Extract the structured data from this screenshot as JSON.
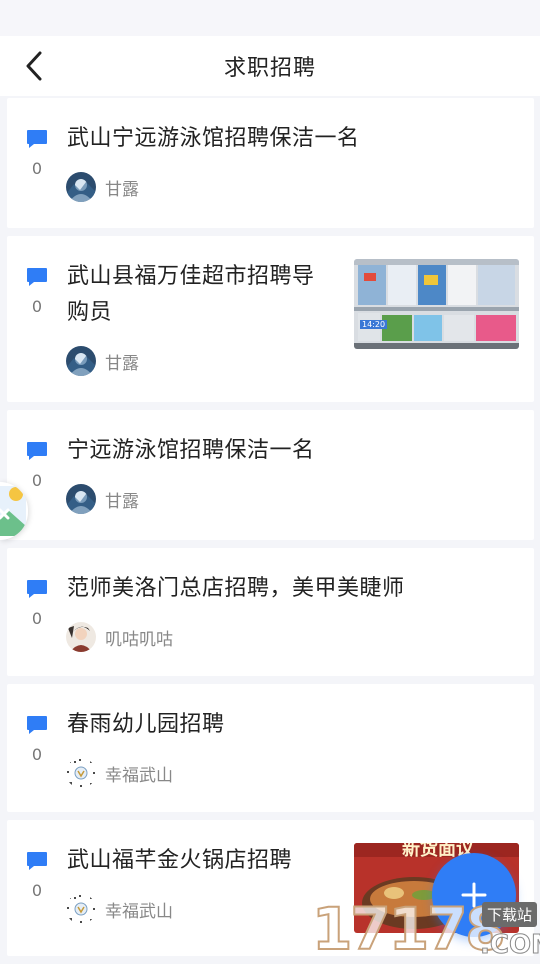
{
  "header": {
    "title": "求职招聘"
  },
  "posts": [
    {
      "title": "武山宁远游泳馆招聘保洁一名",
      "comments": "0",
      "author": "甘露"
    },
    {
      "title_line1": "武山县福万佳超市招聘导",
      "title_line2": "购员",
      "comments": "0",
      "author": "甘露",
      "thumb_overlay": "14:20"
    },
    {
      "title": "宁远游泳馆招聘保洁一名",
      "comments": "0",
      "author": "甘露"
    },
    {
      "title": "范师美洛门总店招聘，美甲美睫师",
      "comments": "0",
      "author": "叽咕叽咕"
    },
    {
      "title": "春雨幼儿园招聘",
      "comments": "0",
      "author": "幸福武山"
    },
    {
      "title": "武山福芊金火锅店招聘",
      "comments": "0",
      "author": "幸福武山",
      "thumb_overlay": "新货面议"
    }
  ],
  "watermark": {
    "big": "17178",
    "com": ".COM",
    "badge": "下载站"
  },
  "colors": {
    "accent": "#2f7df6",
    "background": "#f4f5f9",
    "text": "#222222",
    "muted": "#888888"
  },
  "icons": [
    "back-arrow-icon",
    "comment-icon",
    "plus-icon",
    "image-icon"
  ]
}
